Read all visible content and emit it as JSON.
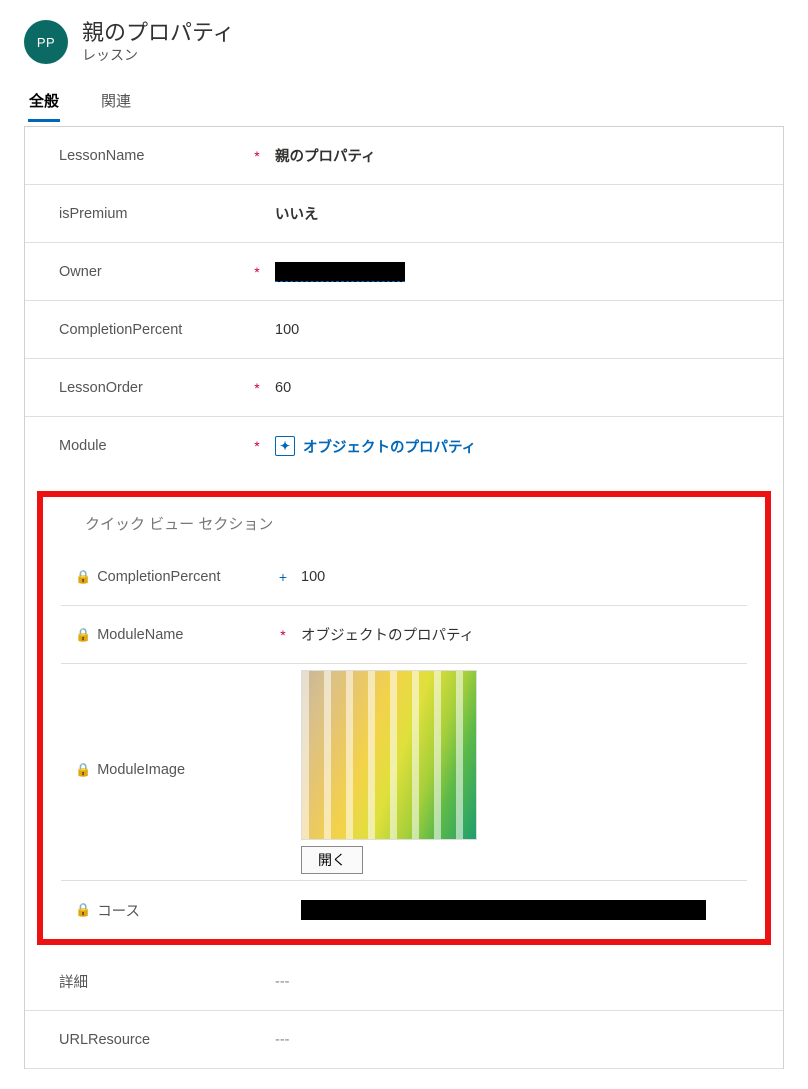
{
  "header": {
    "badge": "PP",
    "title": "親のプロパティ",
    "subtitle": "レッスン"
  },
  "tabs": {
    "general": "全般",
    "related": "関連"
  },
  "fields": {
    "lessonName": {
      "label": "LessonName",
      "value": "親のプロパティ"
    },
    "isPremium": {
      "label": "isPremium",
      "value": "いいえ"
    },
    "owner": {
      "label": "Owner"
    },
    "completionPercent": {
      "label": "CompletionPercent",
      "value": "100"
    },
    "lessonOrder": {
      "label": "LessonOrder",
      "value": "60"
    },
    "module": {
      "label": "Module",
      "value": "オブジェクトのプロパティ"
    },
    "detail": {
      "label": "詳細",
      "value": "---"
    },
    "urlResource": {
      "label": "URLResource",
      "value": "---"
    }
  },
  "quickView": {
    "title": "クイック ビュー セクション",
    "completionPercent": {
      "label": "CompletionPercent",
      "value": "100"
    },
    "moduleName": {
      "label": "ModuleName",
      "value": "オブジェクトのプロパティ"
    },
    "moduleImage": {
      "label": "ModuleImage",
      "openLabel": "開く"
    },
    "course": {
      "label": "コース"
    }
  }
}
